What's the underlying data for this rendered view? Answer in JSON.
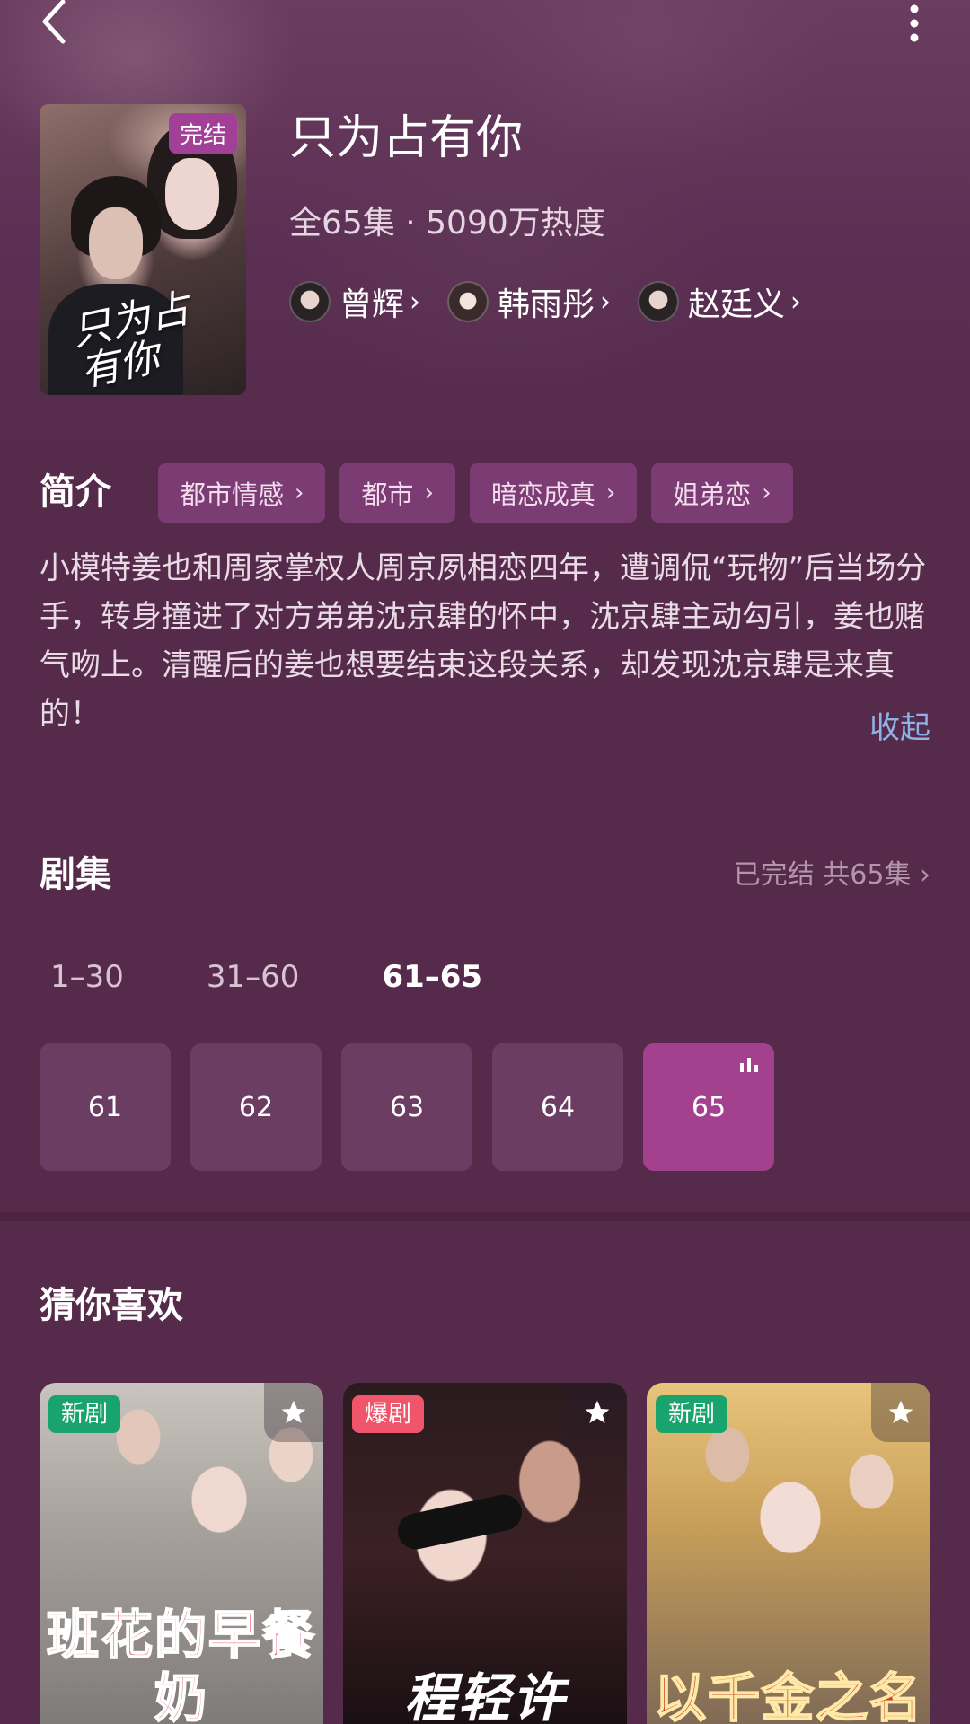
{
  "header": {
    "back_icon": "chevron-left-icon",
    "more_icon": "more-vertical-icon"
  },
  "drama": {
    "poster_badge": "完结",
    "poster_title_art": "只为占有你",
    "title": "只为占有你",
    "meta": "全65集 · 5090万热度",
    "cast": [
      {
        "name": "曾辉"
      },
      {
        "name": "韩雨彤"
      },
      {
        "name": "赵廷义"
      }
    ]
  },
  "intro": {
    "heading": "简介",
    "tags": [
      "都市情感",
      "都市",
      "暗恋成真",
      "姐弟恋"
    ],
    "text": "小模特姜也和周家掌权人周京夙相恋四年，遭调侃“玩物”后当场分手，转身撞进了对方弟弟沈京肆的怀中，沈京肆主动勾引，姜也赌气吻上。清醒后的姜也想要结束这段关系，却发现沈京肆是来真的！",
    "collapse_label": "收起"
  },
  "episodes": {
    "heading": "剧集",
    "status": "已完结 共65集",
    "ranges": [
      "1–30",
      "31–60",
      "61–65"
    ],
    "active_range": 2,
    "items": [
      "61",
      "62",
      "63",
      "64",
      "65"
    ],
    "current": "65"
  },
  "recommend": {
    "heading": "猜你喜欢",
    "items": [
      {
        "badge": "新剧",
        "title_art": "班花的早餐奶"
      },
      {
        "badge": "爆剧",
        "title_art": "程轻许"
      },
      {
        "badge": "新剧",
        "title_art": "以千金之名"
      }
    ]
  },
  "colors": {
    "background": "#552a4a",
    "tag_bg": "#7b3b73",
    "episode_bg": "#6b3d63",
    "episode_active": "#a3418f",
    "link": "#8fb3e6",
    "badge_new": "#18a46c",
    "badge_hot": "#f0556b"
  }
}
